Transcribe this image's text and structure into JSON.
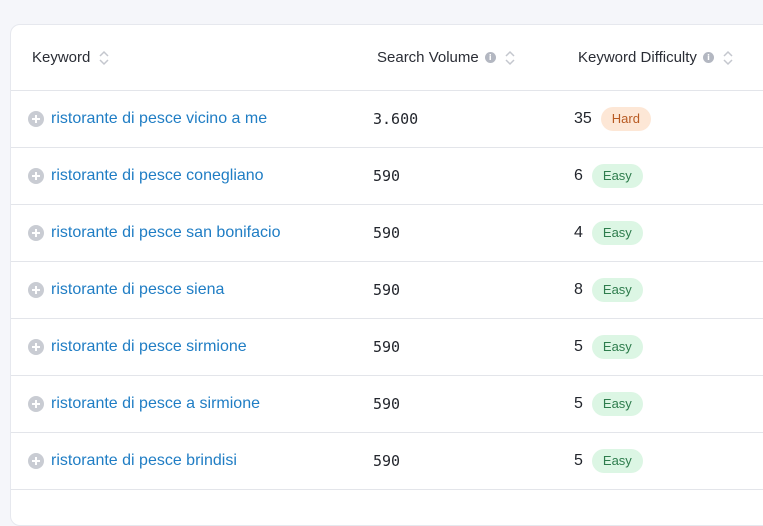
{
  "columns": {
    "keyword": "Keyword",
    "search_volume": "Search Volume",
    "keyword_difficulty": "Keyword Difficulty"
  },
  "difficulty_colors": {
    "Hard": {
      "bg": "#fde7d6",
      "fg": "#b85a22"
    },
    "Easy": {
      "bg": "#dcf6e4",
      "fg": "#2e7d4d"
    }
  },
  "rows": [
    {
      "keyword": "ristorante di pesce vicino a me",
      "volume": "3.600",
      "kd": "35",
      "level": "Hard"
    },
    {
      "keyword": "ristorante di pesce conegliano",
      "volume": "590",
      "kd": "6",
      "level": "Easy"
    },
    {
      "keyword": "ristorante di pesce san bonifacio",
      "volume": "590",
      "kd": "4",
      "level": "Easy"
    },
    {
      "keyword": "ristorante di pesce siena",
      "volume": "590",
      "kd": "8",
      "level": "Easy"
    },
    {
      "keyword": "ristorante di pesce sirmione",
      "volume": "590",
      "kd": "5",
      "level": "Easy"
    },
    {
      "keyword": "ristorante di pesce a sirmione",
      "volume": "590",
      "kd": "5",
      "level": "Easy"
    },
    {
      "keyword": "ristorante di pesce brindisi",
      "volume": "590",
      "kd": "5",
      "level": "Easy"
    }
  ]
}
